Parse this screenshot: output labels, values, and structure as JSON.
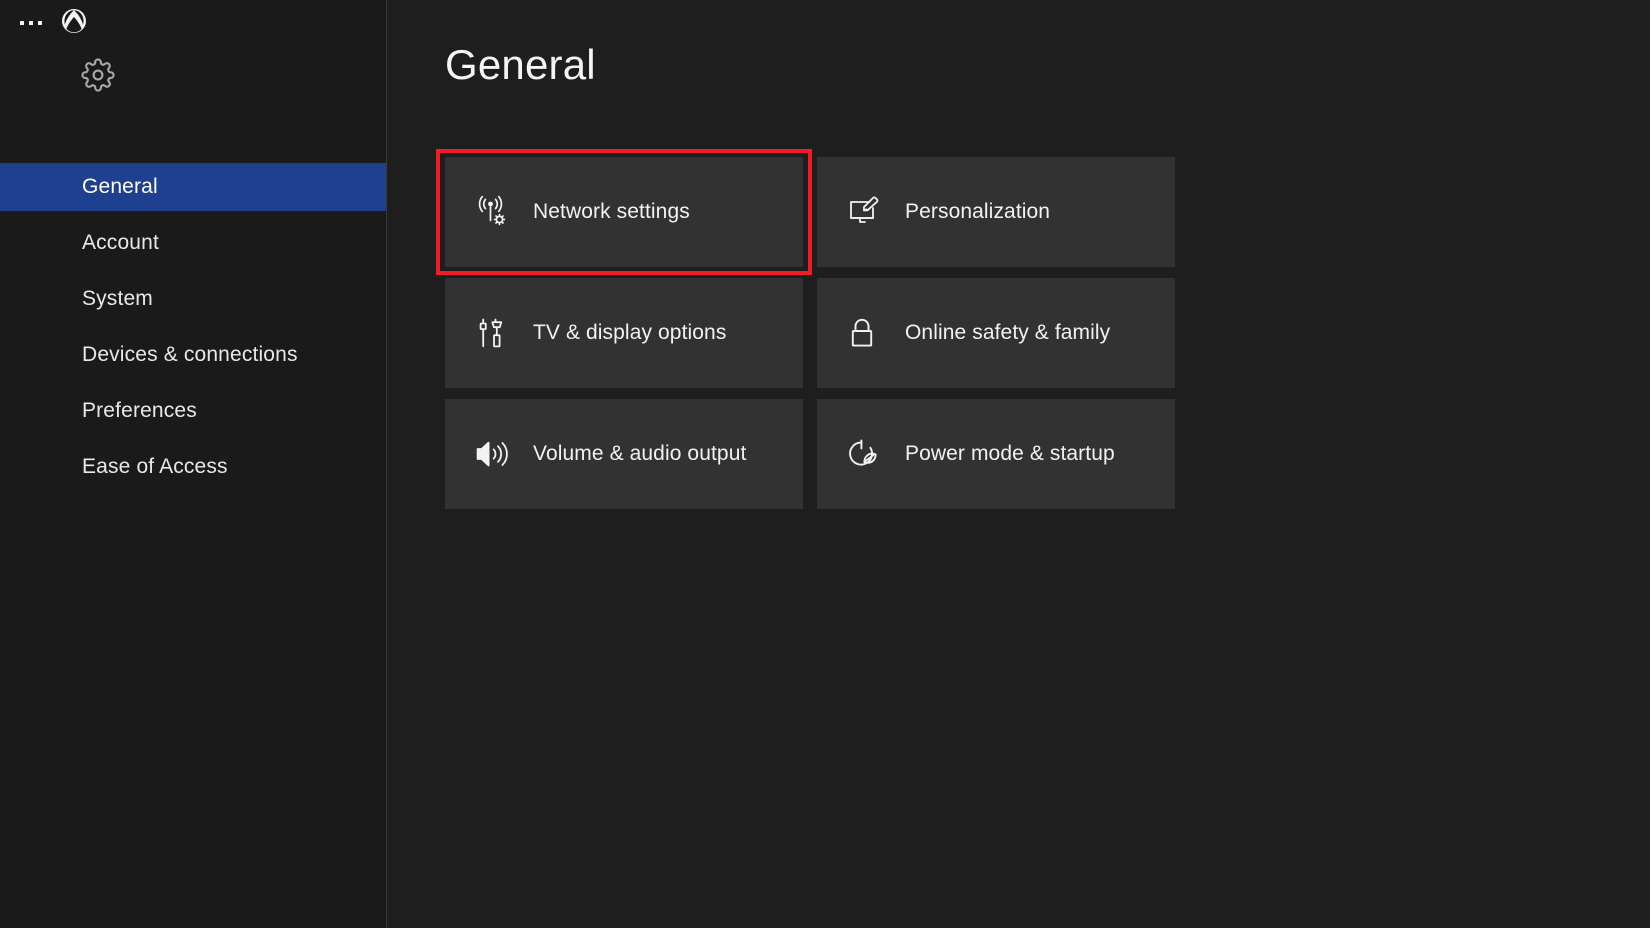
{
  "window": {
    "title": "Xbox Settings"
  },
  "sidebar": {
    "overflow_menu_label": "...",
    "logo_icon": "xbox-logo-icon",
    "settings_tab_icon": "gear-icon",
    "items": [
      {
        "label": "General",
        "selected": true
      },
      {
        "label": "Account",
        "selected": false
      },
      {
        "label": "System",
        "selected": false
      },
      {
        "label": "Devices & connections",
        "selected": false
      },
      {
        "label": "Preferences",
        "selected": false
      },
      {
        "label": "Ease of Access",
        "selected": false
      }
    ]
  },
  "main": {
    "title": "General",
    "tiles": [
      {
        "label": "Network settings",
        "icon": "wireless-network-gear-icon",
        "highlighted": true
      },
      {
        "label": "Personalization",
        "icon": "monitor-paintbrush-icon",
        "highlighted": false
      },
      {
        "label": "TV & display options",
        "icon": "hdmi-cables-icon",
        "highlighted": false
      },
      {
        "label": "Online safety & family",
        "icon": "padlock-icon",
        "highlighted": false
      },
      {
        "label": "Volume & audio output",
        "icon": "speaker-waves-icon",
        "highlighted": false
      },
      {
        "label": "Power mode & startup",
        "icon": "power-leaf-icon",
        "highlighted": false
      }
    ]
  },
  "colors": {
    "app_background": "#1e1e1e",
    "sidebar_background": "#1a1a1a",
    "selected_nav": "#1e408f",
    "tile_background": "#323232",
    "highlight_ring": "#f01c2b",
    "text_primary": "#f2f2f2"
  }
}
